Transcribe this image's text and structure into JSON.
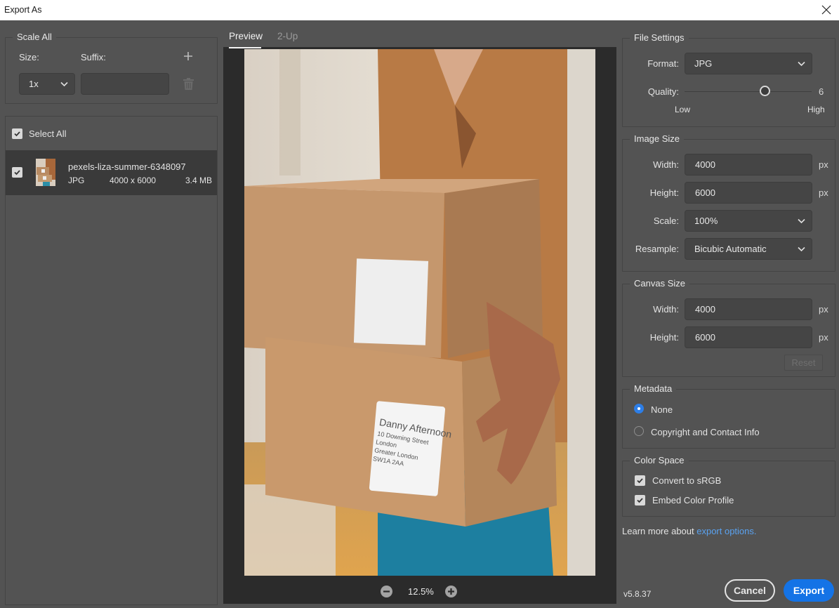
{
  "window": {
    "title": "Export As"
  },
  "scale_all": {
    "legend": "Scale All",
    "size_label": "Size:",
    "suffix_label": "Suffix:",
    "size_value": "1x",
    "suffix_value": ""
  },
  "file_list": {
    "select_all_label": "Select All",
    "select_all_checked": true,
    "items": [
      {
        "name": "pexels-liza-summer-6348097",
        "format": "JPG",
        "dimensions": "4000 x 6000",
        "size": "3.4 MB",
        "checked": true
      }
    ]
  },
  "preview": {
    "tabs": [
      {
        "label": "Preview",
        "active": true
      },
      {
        "label": "2-Up",
        "active": false
      }
    ],
    "zoom_level": "12.5%",
    "label_text": [
      "Danny Afternoon",
      "10 Downing Street",
      "London",
      "Greater London",
      "SW1A 2AA"
    ]
  },
  "file_settings": {
    "legend": "File Settings",
    "format_label": "Format:",
    "format_value": "JPG",
    "quality_label": "Quality:",
    "quality_value": "6",
    "quality_fraction": 0.5,
    "low_label": "Low",
    "high_label": "High"
  },
  "image_size": {
    "legend": "Image Size",
    "width_label": "Width:",
    "width_value": "4000",
    "height_label": "Height:",
    "height_value": "6000",
    "scale_label": "Scale:",
    "scale_value": "100%",
    "resample_label": "Resample:",
    "resample_value": "Bicubic Automatic",
    "unit": "px"
  },
  "canvas_size": {
    "legend": "Canvas Size",
    "width_label": "Width:",
    "width_value": "4000",
    "height_label": "Height:",
    "height_value": "6000",
    "unit": "px",
    "reset_label": "Reset"
  },
  "metadata": {
    "legend": "Metadata",
    "options": [
      {
        "label": "None",
        "selected": true
      },
      {
        "label": "Copyright and Contact Info",
        "selected": false
      }
    ]
  },
  "color_space": {
    "legend": "Color Space",
    "options": [
      {
        "label": "Convert to sRGB",
        "checked": true
      },
      {
        "label": "Embed Color Profile",
        "checked": true
      }
    ]
  },
  "learn_more": {
    "prefix": "Learn more about ",
    "link": "export options."
  },
  "footer": {
    "version": "v5.8.37",
    "cancel_label": "Cancel",
    "export_label": "Export"
  },
  "colors": {
    "accent": "#1473e6",
    "link": "#5aa2f0",
    "radio_selected": "#2d7ee7",
    "background": "#535353"
  }
}
